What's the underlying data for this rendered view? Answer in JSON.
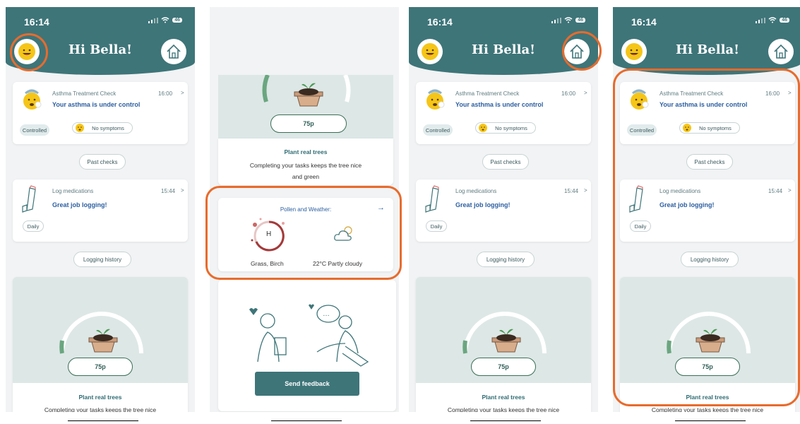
{
  "header": {
    "time": "16:14",
    "battery": "46",
    "greeting": "Hi Bella!"
  },
  "asthma_card": {
    "title": "Asthma Treatment Check",
    "time": "16:00",
    "message": "Your asthma is under control",
    "tags": [
      "Controlled",
      "No symptoms"
    ]
  },
  "past_checks": "Past checks",
  "log_card": {
    "title": "Log medications",
    "time": "15:44",
    "message": "Great job logging!",
    "tag": "Daily"
  },
  "logging_history": "Logging history",
  "tree_card": {
    "points": "75p",
    "title": "Plant real trees",
    "description_line1": "Completing your tasks keeps the tree nice",
    "description_line2": "and green"
  },
  "pollen_card": {
    "title": "Pollen and Weather:",
    "pollen_level": "H",
    "pollen_types": "Grass, Birch",
    "weather": "22°C Partly cloudy"
  },
  "feedback_card": {
    "button": "Send feedback"
  },
  "icons": [
    "chevron-right-icon",
    "home-icon",
    "smiley-avatar-icon",
    "arrow-right-icon",
    "partly-cloudy-icon",
    "inhaler-icon",
    "worried-face-icon"
  ],
  "colors": {
    "header": "#3e7579",
    "highlight": "#e86b2c",
    "link": "#2c5fa0",
    "tree_bg": "#dde7e6"
  }
}
